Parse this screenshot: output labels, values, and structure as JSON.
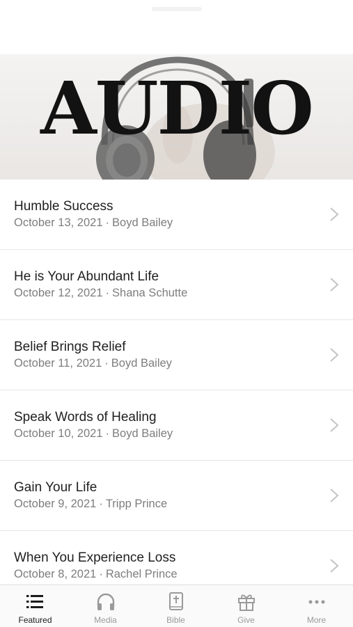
{
  "banner": {
    "title": "AUDIO"
  },
  "episodes": [
    {
      "title": "Humble Success",
      "date": "October 13, 2021",
      "author": "Boyd Bailey"
    },
    {
      "title": "He is Your Abundant Life",
      "date": "October 12, 2021",
      "author": "Shana Schutte"
    },
    {
      "title": "Belief Brings Relief",
      "date": "October 11, 2021",
      "author": "Boyd Bailey"
    },
    {
      "title": "Speak Words of Healing",
      "date": "October 10, 2021",
      "author": "Boyd Bailey"
    },
    {
      "title": "Gain Your Life",
      "date": "October 9, 2021",
      "author": "Tripp Prince"
    },
    {
      "title": "When You Experience Loss",
      "date": "October 8, 2021",
      "author": "Rachel Prince"
    }
  ],
  "tabs": [
    {
      "label": "Featured",
      "icon": "list-icon",
      "active": true
    },
    {
      "label": "Media",
      "icon": "headphones-icon",
      "active": false
    },
    {
      "label": "Bible",
      "icon": "bible-icon",
      "active": false
    },
    {
      "label": "Give",
      "icon": "gift-icon",
      "active": false
    },
    {
      "label": "More",
      "icon": "more-dots-icon",
      "active": false
    }
  ],
  "colors": {
    "active_tab": "#1c1c1c",
    "inactive_tab": "#9a9a9a",
    "meta_text": "#7d7d7d"
  }
}
